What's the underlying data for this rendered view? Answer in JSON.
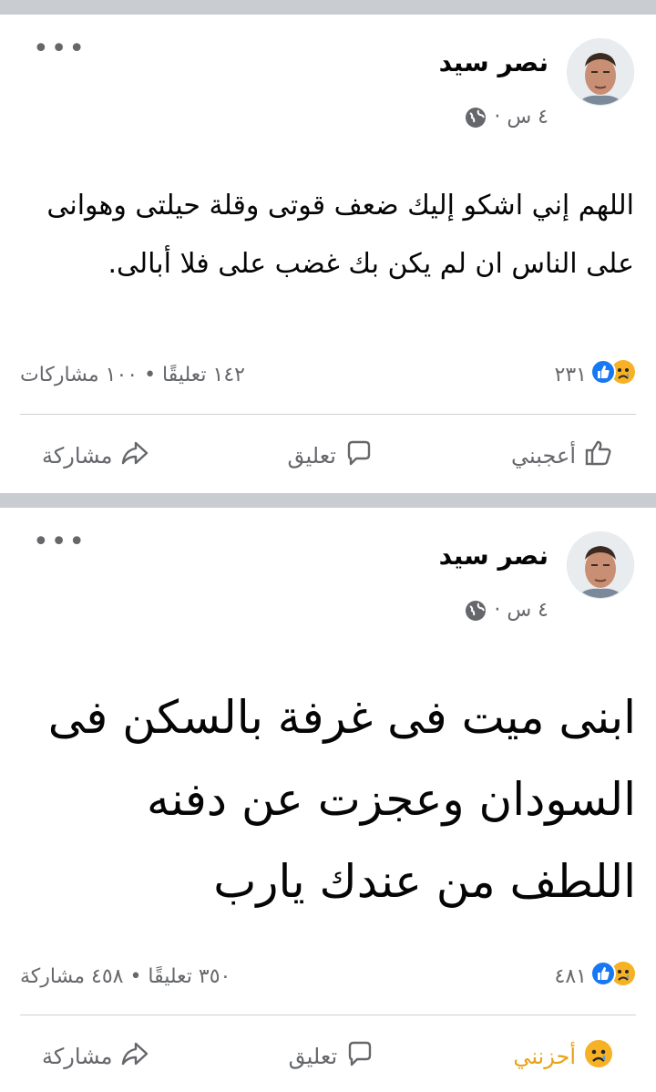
{
  "posts": [
    {
      "author": "نصر سيد",
      "time": "٤ س ·",
      "text": "اللهم إني اشكو إليك ضعف قوتى وقلة حيلتى وهوانى على الناس ان لم يكن بك غضب على فلا أبالى.",
      "reactions_count": "٢٣١",
      "stats": "١٤٢ تعليقًا • ١٠٠ مشاركات",
      "reaction_label": "أعجبني",
      "comment_label": "تعليق",
      "share_label": "مشاركة"
    },
    {
      "author": "نصر سيد",
      "time": "٤ س ·",
      "text": "ابنى ميت فى غرفة بالسكن فى السودان وعجزت عن دفنه اللطف من عندك يارب",
      "reactions_count": "٤٨١",
      "stats": "٣٥٠ تعليقًا • ٤٥٨ مشاركة",
      "reaction_label": "أحزنني",
      "comment_label": "تعليق",
      "share_label": "مشاركة"
    }
  ],
  "colors": {
    "separator": "#c9ccd1",
    "like_blue": "#1877f2",
    "sad_yellow": "#f7b125",
    "secondary_text": "#65676b"
  }
}
